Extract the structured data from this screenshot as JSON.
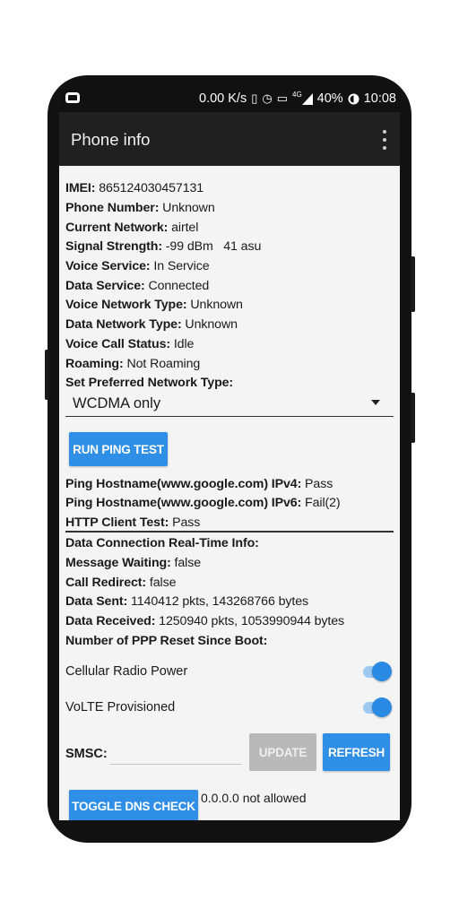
{
  "status_bar": {
    "speed": "0.00 K/s",
    "network_badge": "4G",
    "battery": "40%",
    "time": "10:08",
    "icons": [
      "vibrate-icon",
      "alarm-icon",
      "no-sim-icon",
      "signal-icon",
      "battery-saver-icon"
    ]
  },
  "app_bar": {
    "title": "Phone info"
  },
  "info": [
    {
      "label": "IMEI:",
      "value": " 865124030457131"
    },
    {
      "label": "Phone Number:",
      "value": " Unknown"
    },
    {
      "label": "Current Network:",
      "value": " airtel"
    },
    {
      "label": "Signal Strength:",
      "value": " -99 dBm   41 asu"
    },
    {
      "label": "Voice Service:",
      "value": " In Service"
    },
    {
      "label": "Data Service:",
      "value": " Connected"
    },
    {
      "label": "Voice Network Type:",
      "value": " Unknown"
    },
    {
      "label": "Data Network Type:",
      "value": " Unknown"
    },
    {
      "label": "Voice Call Status:",
      "value": " Idle"
    },
    {
      "label": "Roaming:",
      "value": " Not Roaming"
    },
    {
      "label": "Set Preferred Network Type:",
      "value": ""
    }
  ],
  "network_type_select": {
    "value": "WCDMA only"
  },
  "ping": {
    "button_label": "RUN PING TEST",
    "results": [
      {
        "label": "Ping Hostname(www.google.com) IPv4:",
        "value": " Pass"
      },
      {
        "label": "Ping Hostname(www.google.com) IPv6:",
        "value": " Fail(2)"
      },
      {
        "label": "HTTP Client Test:",
        "value": " Pass"
      }
    ]
  },
  "data_info": [
    {
      "label": "Data Connection Real-Time Info:",
      "value": ""
    },
    {
      "label": "Message Waiting:",
      "value": " false"
    },
    {
      "label": "Call Redirect:",
      "value": " false"
    },
    {
      "label": "Data Sent:",
      "value": " 1140412 pkts, 143268766 bytes"
    },
    {
      "label": "Data Received:",
      "value": " 1250940 pkts, 1053990944 bytes"
    },
    {
      "label": "Number of PPP Reset Since Boot:",
      "value": ""
    }
  ],
  "switches": [
    {
      "label": "Cellular Radio Power",
      "on": true
    },
    {
      "label": "VoLTE Provisioned",
      "on": true
    }
  ],
  "smsc": {
    "label": "SMSC:",
    "value": "",
    "update_label": "UPDATE",
    "refresh_label": "REFRESH"
  },
  "dns": {
    "button_label": "TOGGLE DNS CHECK",
    "status": "0.0.0.0 not allowed"
  },
  "colors": {
    "accent": "#2f8fe6",
    "app_bar": "#202020",
    "status_bar": "#111111",
    "background": "#f4f4f4"
  }
}
